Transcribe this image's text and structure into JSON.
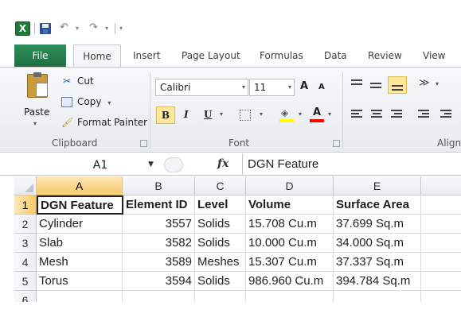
{
  "quick_access": {
    "app_icon": "excel-icon",
    "app_icon_letter": "X",
    "icons": [
      "save-icon",
      "undo-icon",
      "redo-icon",
      "customize-qat-icon"
    ],
    "undo_glyph": "↶",
    "redo_glyph": "↷",
    "dropdown_glyph": "▾"
  },
  "ribbon_tabs": {
    "file": "File",
    "home": "Home",
    "insert": "Insert",
    "page_layout": "Page Layout",
    "formulas": "Formulas",
    "data": "Data",
    "review": "Review",
    "view": "View"
  },
  "clipboard": {
    "paste": "Paste",
    "cut": "Cut",
    "copy": "Copy",
    "copy_caret": "▾",
    "format_painter": "Format Painter",
    "group_label": "Clipboard"
  },
  "font": {
    "font_name": "Calibri",
    "font_size": "11",
    "grow_font": "A",
    "shrink_font": "A",
    "bold": "B",
    "italic": "I",
    "underline": "U",
    "group_label": "Font",
    "fill_color": "#ffff00",
    "font_color": "#ff0000"
  },
  "alignment": {
    "group_label": "Align",
    "wrap_glyph": "≫"
  },
  "formula_bar": {
    "name_box": "A1",
    "fx_label": "fx",
    "formula": "DGN Feature"
  },
  "sheet": {
    "columns": [
      "A",
      "B",
      "C",
      "D",
      "E"
    ],
    "rows": [
      "1",
      "2",
      "3",
      "4",
      "5",
      "6"
    ],
    "header": [
      "DGN Feature",
      "Element ID",
      "Level",
      "Volume",
      "Surface Area"
    ],
    "data": [
      [
        "Cylinder",
        "3557",
        "Solids",
        "15.708 Cu.m",
        "37.699 Sq.m"
      ],
      [
        "Slab",
        "3582",
        "Solids",
        "10.000 Cu.m",
        "34.000 Sq.m"
      ],
      [
        "Mesh",
        "3589",
        "Meshes",
        "15.307 Cu.m",
        "37.337 Sq.m"
      ],
      [
        "Torus",
        "3594",
        "Solids",
        "986.960 Cu.m",
        "394.784 Sq.m"
      ]
    ],
    "selection_color": "#f7c96a"
  }
}
